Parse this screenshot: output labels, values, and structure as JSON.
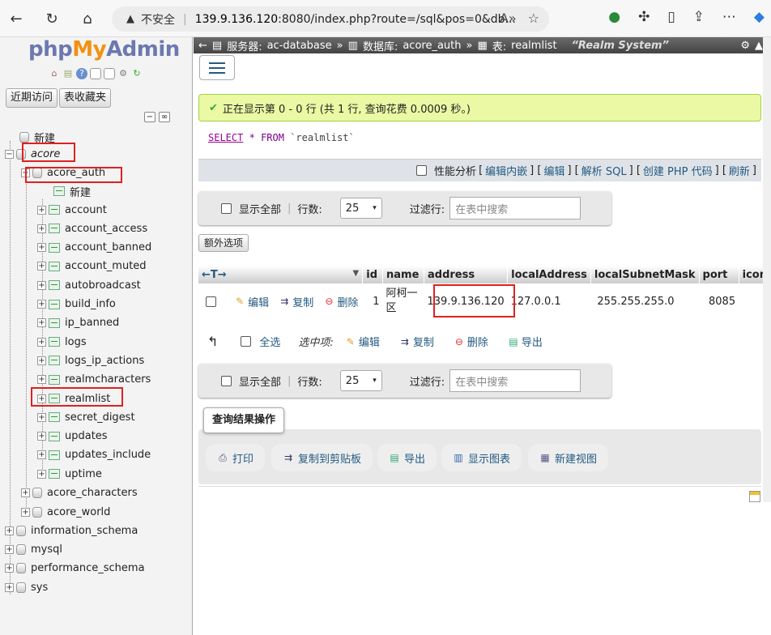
{
  "browser": {
    "warning": "不安全",
    "url_host": "139.9.136.120",
    "url_rest": ":8080/index.php?route=/sql&pos=0&db..."
  },
  "sidebar": {
    "logo": {
      "php": "php",
      "my": "My",
      "admin": "Admin"
    },
    "recent_label": "近期访问",
    "favorites_label": "表收藏夹",
    "new_label": "新建",
    "databases": [
      {
        "name": "acore",
        "italic": true
      },
      {
        "name": "acore_auth"
      },
      {
        "name": "acore_characters"
      },
      {
        "name": "acore_world"
      },
      {
        "name": "information_schema"
      },
      {
        "name": "mysql"
      },
      {
        "name": "performance_schema"
      },
      {
        "name": "sys"
      }
    ],
    "auth_new": "新建",
    "tables": [
      "account",
      "account_access",
      "account_banned",
      "account_muted",
      "autobroadcast",
      "build_info",
      "ip_banned",
      "logs",
      "logs_ip_actions",
      "realmcharacters",
      "realmlist",
      "secret_digest",
      "updates",
      "updates_include",
      "uptime"
    ]
  },
  "breadcrumb": {
    "server_label": "服务器:",
    "server": "ac-database",
    "db_label": "数据库:",
    "db": "acore_auth",
    "table_label": "表:",
    "table": "realmlist",
    "comment": "“Realm System”"
  },
  "message": "正在显示第 0 - 0 行 (共 1 行, 查询花费 0.0009 秒。)",
  "sql": {
    "select": "SELECT",
    "star": "*",
    "from": "FROM",
    "table": "`realmlist`"
  },
  "sqlbar": {
    "profiling": "性能分析",
    "links": [
      "编辑内嵌",
      "编辑",
      "解析 SQL",
      "创建 PHP 代码",
      "刷新"
    ]
  },
  "nav": {
    "show_all": "显示全部",
    "rows_label": "行数:",
    "rows_value": "25",
    "filter_label": "过滤行:",
    "filter_placeholder": "在表中搜索"
  },
  "extra_options": "额外选项",
  "table": {
    "arrows": "←T→",
    "columns": [
      "id",
      "name",
      "address",
      "localAddress",
      "localSubnetMask",
      "port",
      "icon"
    ],
    "row": {
      "edit": "编辑",
      "copy": "复制",
      "delete": "删除",
      "id": "1",
      "name_line1": "阿柯一",
      "name_line2": "区",
      "address": "139.9.136.120",
      "localAddress": "127.0.0.1",
      "localSubnetMask": "255.255.255.0",
      "port": "8085"
    }
  },
  "bulk": {
    "select_all": "全选",
    "with_selected": "选中项:",
    "edit": "编辑",
    "copy": "复制",
    "delete": "删除",
    "export": "导出"
  },
  "query_ops": {
    "title": "查询结果操作",
    "buttons": [
      "打印",
      "复制到剪贴板",
      "导出",
      "显示图表",
      "新建视图"
    ]
  }
}
